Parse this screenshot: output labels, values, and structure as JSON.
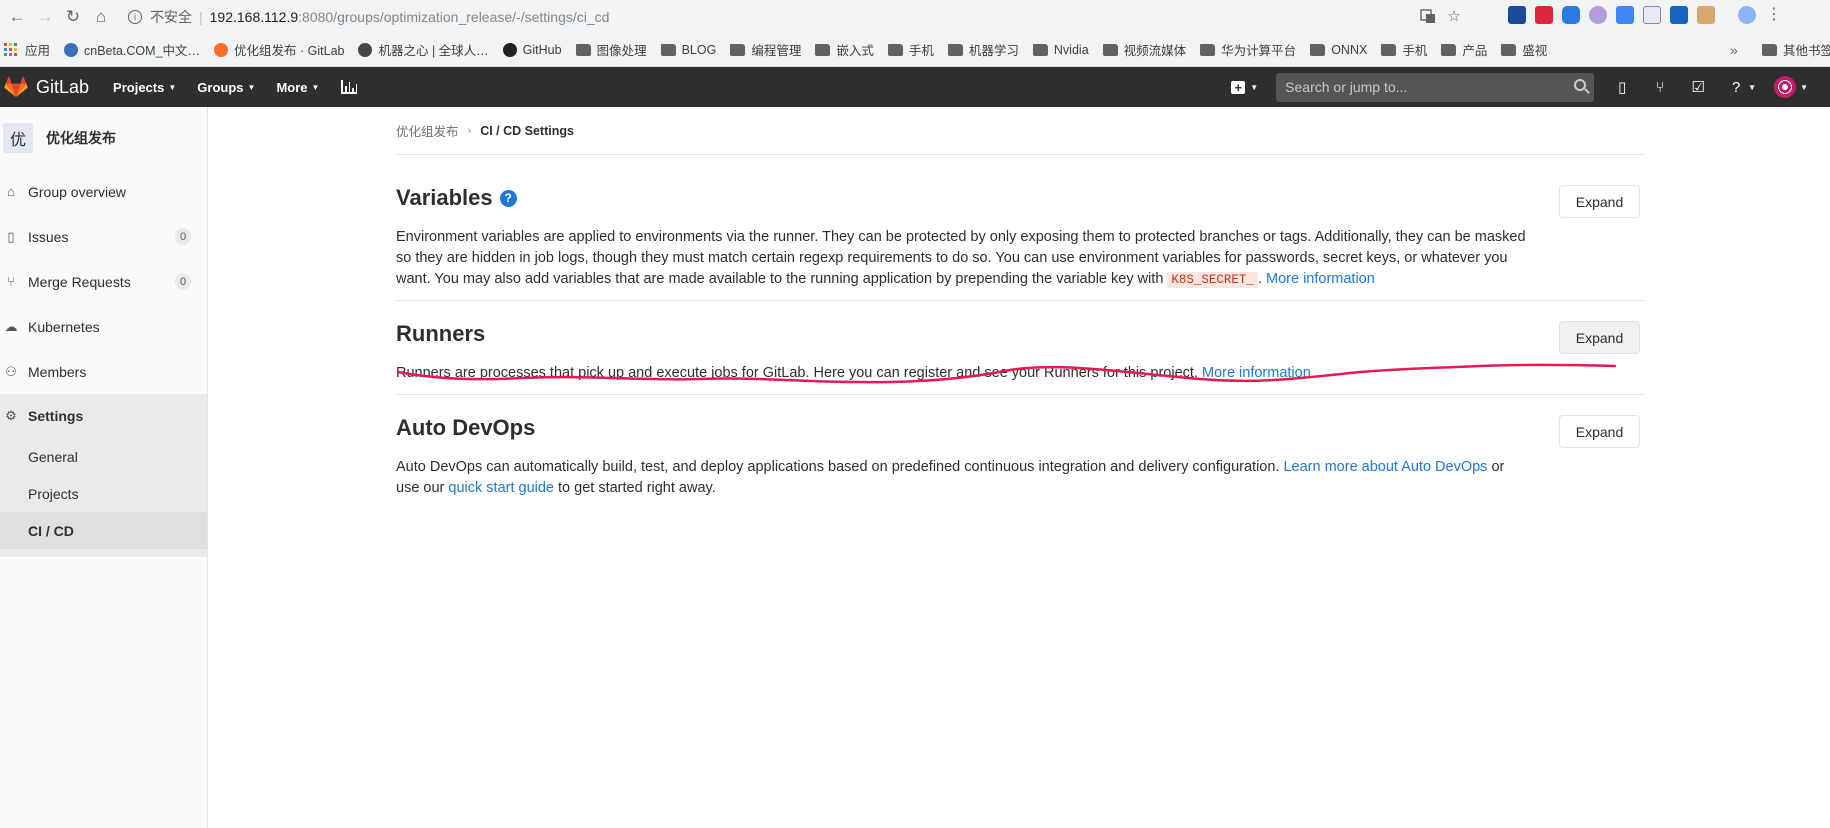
{
  "browser": {
    "insecure_label": "不安全",
    "url_host": "192.168.112.9",
    "url_path": ":8080/groups/optimization_release/-/settings/ci_cd",
    "bookmarks": [
      {
        "label": "应用",
        "icon": "apps-grid"
      },
      {
        "label": "cnBeta.COM_中文…",
        "icon": "cnbeta-icon"
      },
      {
        "label": "优化组发布 · GitLab",
        "icon": "gitlab-icon"
      },
      {
        "label": "机器之心 | 全球人…",
        "icon": "jiqizhixin-icon"
      },
      {
        "label": "GitHub",
        "icon": "github-icon"
      },
      {
        "label": "图像处理",
        "icon": "folder"
      },
      {
        "label": "BLOG",
        "icon": "folder"
      },
      {
        "label": "编程管理",
        "icon": "folder"
      },
      {
        "label": "嵌入式",
        "icon": "folder"
      },
      {
        "label": "手机",
        "icon": "folder"
      },
      {
        "label": "机器学习",
        "icon": "folder"
      },
      {
        "label": "Nvidia",
        "icon": "folder"
      },
      {
        "label": "视频流媒体",
        "icon": "folder"
      },
      {
        "label": "华为计算平台",
        "icon": "folder"
      },
      {
        "label": "ONNX",
        "icon": "folder"
      },
      {
        "label": "手机",
        "icon": "folder"
      },
      {
        "label": "产品",
        "icon": "folder"
      },
      {
        "label": "盛视",
        "icon": "folder"
      }
    ],
    "more_bookmarks": "»",
    "other_bookmarks": "其他书签"
  },
  "navbar": {
    "brand": "GitLab",
    "items": [
      {
        "label": "Projects"
      },
      {
        "label": "Groups"
      },
      {
        "label": "More"
      }
    ],
    "search_placeholder": "Search or jump to..."
  },
  "sidebar": {
    "group_initial": "优",
    "group_name": "优化组发布",
    "items": [
      {
        "label": "Group overview",
        "icon": "home-icon"
      },
      {
        "label": "Issues",
        "icon": "issues-icon",
        "count": "0"
      },
      {
        "label": "Merge Requests",
        "icon": "merge-request-icon",
        "count": "0"
      },
      {
        "label": "Kubernetes",
        "icon": "cloud-icon"
      },
      {
        "label": "Members",
        "icon": "users-icon"
      },
      {
        "label": "Settings",
        "icon": "gear-icon"
      }
    ],
    "settings_sub": [
      {
        "label": "General"
      },
      {
        "label": "Projects"
      },
      {
        "label": "CI / CD"
      }
    ]
  },
  "breadcrumb": {
    "parent": "优化组发布",
    "current": "CI / CD Settings"
  },
  "sections": {
    "variables": {
      "title": "Variables",
      "desc_pre": "Environment variables are applied to environments via the runner. They can be protected by only exposing them to protected branches or tags. Additionally, they can be masked so they are hidden in job logs, though they must match certain regexp requirements to do so. You can use environment variables for passwords, secret keys, or whatever you want. You may also add variables that are made available to the running application by prepending the variable key with ",
      "code": "K8S_SECRET_",
      "desc_post": ". ",
      "link": "More information",
      "button": "Expand"
    },
    "runners": {
      "title": "Runners",
      "desc": "Runners are processes that pick up and execute jobs for GitLab. Here you can register and see your Runners for this project. ",
      "link": "More information",
      "button": "Expand"
    },
    "autodevops": {
      "title": "Auto DevOps",
      "desc_pre": "Auto DevOps can automatically build, test, and deploy applications based on predefined continuous integration and delivery configuration. ",
      "link1": "Learn more about Auto DevOps",
      "desc_mid": " or use our ",
      "link2": "quick start guide",
      "desc_post": " to get started right away.",
      "button": "Expand"
    }
  },
  "colors": {
    "navbar": "#2e2e2e",
    "link": "#1f78d1",
    "annotation": "#e8194e"
  }
}
